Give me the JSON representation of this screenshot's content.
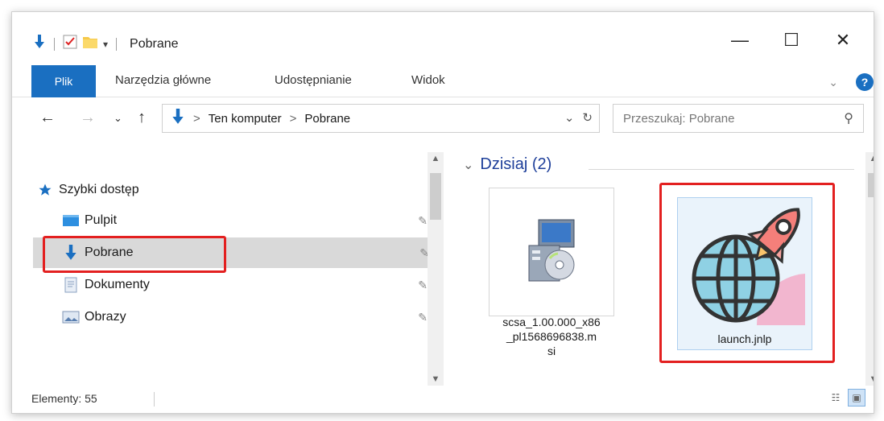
{
  "window": {
    "title": "Pobrane"
  },
  "window_controls": {
    "minimize": "—",
    "maximize": "☐",
    "close": "✕"
  },
  "qat": {
    "dropdown": "▾"
  },
  "ribbon": {
    "file_tab": "Plik",
    "tabs": [
      "Narzędzia główne",
      "Udostępnianie",
      "Widok"
    ],
    "expand": "⌄",
    "help": "?"
  },
  "nav": {
    "back": "←",
    "forward": "→",
    "recent": "⌄",
    "up": "↑"
  },
  "address": {
    "separator": ">",
    "crumbs": [
      "Ten komputer",
      "Pobrane"
    ],
    "dropdown": "⌄",
    "refresh": "↻"
  },
  "search": {
    "placeholder": "Przeszukaj: Pobrane",
    "icon": "⚲"
  },
  "navpane": {
    "quick_access": "Szybki dostęp",
    "items": [
      {
        "label": "Pulpit",
        "icon": "desktop-icon"
      },
      {
        "label": "Pobrane",
        "icon": "download-arrow-icon",
        "selected": true
      },
      {
        "label": "Dokumenty",
        "icon": "documents-icon"
      },
      {
        "label": "Obrazy",
        "icon": "pictures-icon"
      }
    ]
  },
  "content": {
    "group": {
      "chevron": "⌄",
      "label": "Dzisiaj (2)"
    },
    "files": [
      {
        "name": "scsa_1.00.000_x86_pl1568696838.msi",
        "lines": [
          "scsa_1.00.000_x86",
          "_pl1568696838.m",
          "si"
        ],
        "icon": "msi-installer-icon"
      },
      {
        "name": "launch.jnlp",
        "lines": [
          "launch.jnlp"
        ],
        "icon": "globe-rocket-icon",
        "highlighted": true
      }
    ]
  },
  "status": {
    "count": "Elementy: 55"
  },
  "accent": {
    "blue": "#1a6fc1",
    "highlight_red": "#e32020",
    "group_header": "#1e3f9a"
  }
}
